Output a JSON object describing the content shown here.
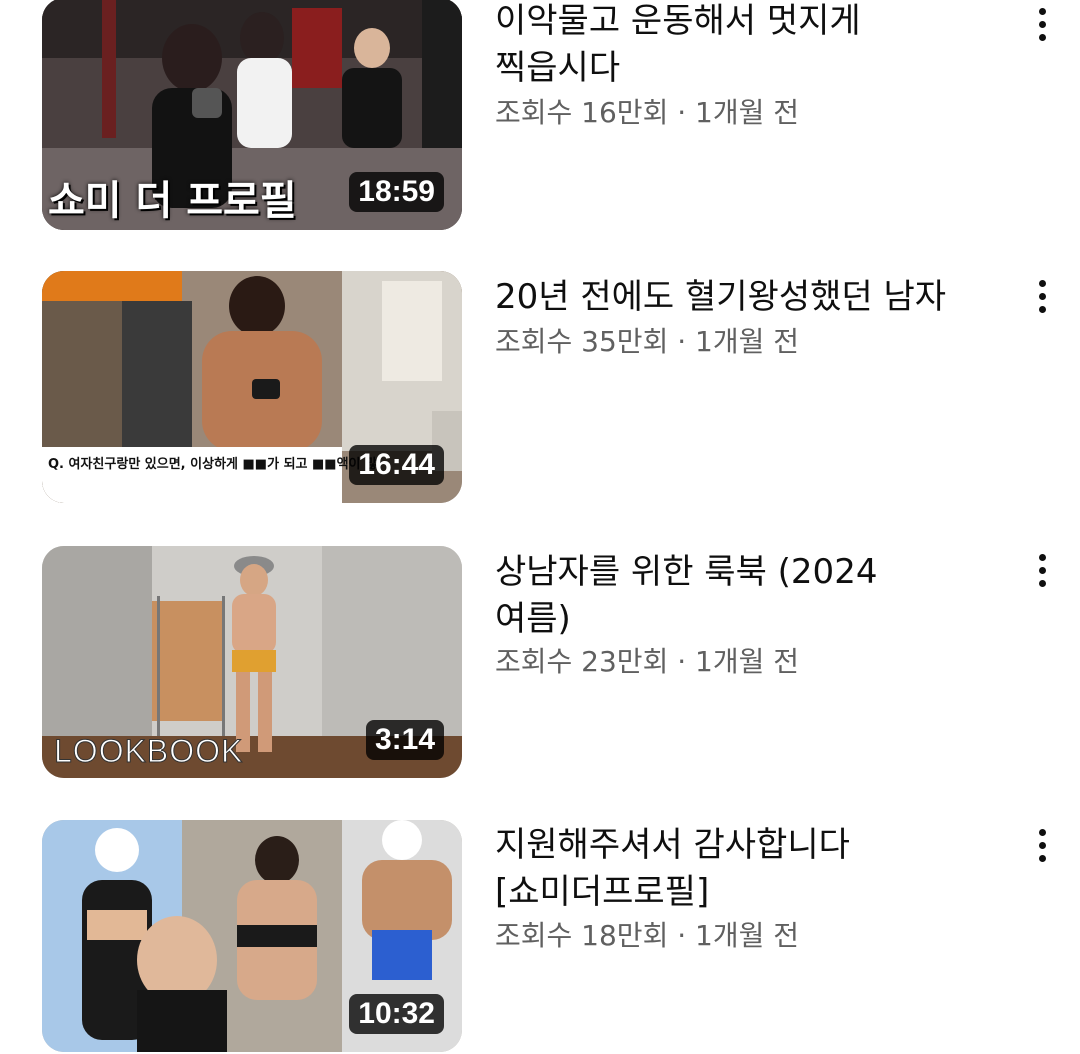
{
  "videos": [
    {
      "title": "이악물고 운동해서 멋지게\n찍읍시다",
      "meta": "조회수 16만회 · 1개월 전",
      "duration": "18:59",
      "thumbnail_text": "쇼미 더 프로필"
    },
    {
      "title": "20년 전에도 혈기왕성했던 남자",
      "meta": "조회수 35만회 · 1개월 전",
      "duration": "16:44",
      "thumbnail_text": "Q. 여자친구랑만 있으면, 이상하게 ■■가 되고 ■■액이 많"
    },
    {
      "title": "상남자를 위한 룩북 (2024\n여름)",
      "meta": "조회수 23만회 · 1개월 전",
      "duration": "3:14",
      "thumbnail_text": "LOOKBOOK"
    },
    {
      "title": "지원해주셔서 감사합니다\n[쇼미더프로필]",
      "meta": "조회수 18만회 · 1개월 전",
      "duration": "10:32",
      "thumbnail_text": ""
    }
  ],
  "icons": {
    "more": "more-vert-icon"
  },
  "colors": {
    "title": "#0f0f0f",
    "meta": "#606060",
    "duration_bg": "#000000"
  }
}
